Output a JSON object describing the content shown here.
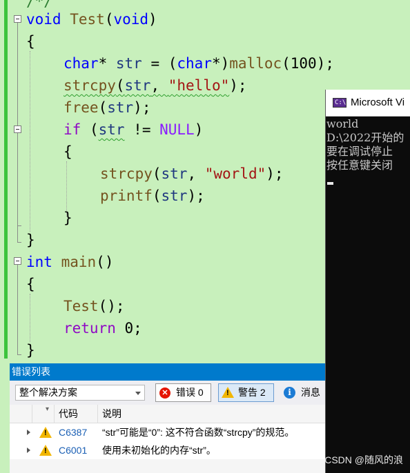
{
  "editor": {
    "top_fragment": "/*/",
    "lines": {
      "l1": {
        "kw": "void",
        "fn": "Test",
        "paren_open": "(",
        "kw2": "void",
        "paren_close": ")"
      },
      "l2": "{",
      "l3": {
        "kw": "char",
        "star": "* ",
        "var": "str",
        "op": " = (",
        "kw2": "char",
        "cast_close": "*)",
        "fn": "malloc",
        "rest": "(100);"
      },
      "l4": {
        "fn": "strcpy",
        "p1": "(",
        "var": "str",
        "sep": ", ",
        "str": "\"hello\"",
        "end": ");"
      },
      "l5": {
        "fn": "free",
        "p1": "(",
        "var": "str",
        "end": ");"
      },
      "l6": {
        "ctl": "if",
        "p1": " (",
        "var": "str",
        "op": " != ",
        "mac": "NULL",
        "end": ")"
      },
      "l7": "{",
      "l8": {
        "fn": "strcpy",
        "p1": "(",
        "var": "str",
        "sep": ", ",
        "str": "\"world\"",
        "end": ");"
      },
      "l9": {
        "fn": "printf",
        "p1": "(",
        "var": "str",
        "end": ");"
      },
      "l10": "}",
      "l11": "}",
      "l12": {
        "kw": "int",
        "fn": "main",
        "end": "()"
      },
      "l13": "{",
      "l14": {
        "fn": "Test",
        "end": "();"
      },
      "l15": {
        "ctl": "return",
        "end": " 0;"
      },
      "l16": "}"
    }
  },
  "console": {
    "title": "Microsoft Vi",
    "output": [
      "world",
      "D:\\2022开始的",
      "要在调试停止",
      "按任意键关闭"
    ]
  },
  "error_list": {
    "title": "错误列表",
    "scope": "整个解决方案",
    "errors_label": "错误 0",
    "warnings_label": "警告 2",
    "messages_label": "消息",
    "columns": {
      "code": "代码",
      "description": "说明"
    },
    "rows": [
      {
        "code": "C6387",
        "description": "“str”可能是“0”: 这不符合函数“strcpy”的规范。"
      },
      {
        "code": "C6001",
        "description": "使用未初始化的内存“str”。"
      }
    ]
  },
  "watermark": "CSDN @随风的浪",
  "colors": {
    "editor_bg": "#c8f0bc",
    "accent": "#007acc",
    "keyword": "#0000ff",
    "string": "#a31515",
    "error": "#e51400",
    "warning": "#f2b600"
  }
}
